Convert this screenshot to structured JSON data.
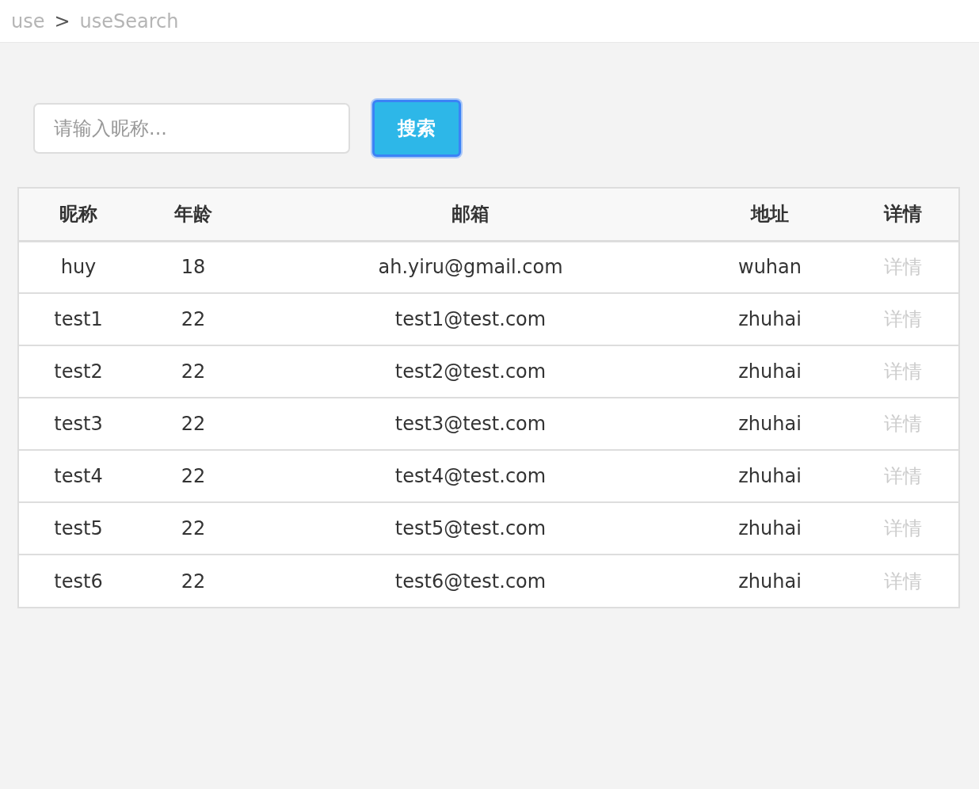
{
  "breadcrumb": [
    {
      "label": "use"
    },
    {
      "label": ">"
    },
    {
      "label": "useSearch"
    }
  ],
  "search": {
    "placeholder": "请输入昵称...",
    "button": "搜索"
  },
  "table": {
    "columns": [
      "昵称",
      "年龄",
      "邮箱",
      "地址",
      "详情"
    ],
    "rows": [
      {
        "cells": [
          "huy",
          "18",
          "ah.yiru@gmail.com",
          "wuhan"
        ],
        "action": "详情"
      },
      {
        "cells": [
          "test1",
          "22",
          "test1@test.com",
          "zhuhai"
        ],
        "action": "详情"
      },
      {
        "cells": [
          "test2",
          "22",
          "test2@test.com",
          "zhuhai"
        ],
        "action": "详情"
      },
      {
        "cells": [
          "test3",
          "22",
          "test3@test.com",
          "zhuhai"
        ],
        "action": "详情"
      },
      {
        "cells": [
          "test4",
          "22",
          "test4@test.com",
          "zhuhai"
        ],
        "action": "详情"
      },
      {
        "cells": [
          "test5",
          "22",
          "test5@test.com",
          "zhuhai"
        ],
        "action": "详情"
      },
      {
        "cells": [
          "test6",
          "22",
          "test6@test.com",
          "zhuhai"
        ],
        "action": "详情"
      }
    ]
  }
}
